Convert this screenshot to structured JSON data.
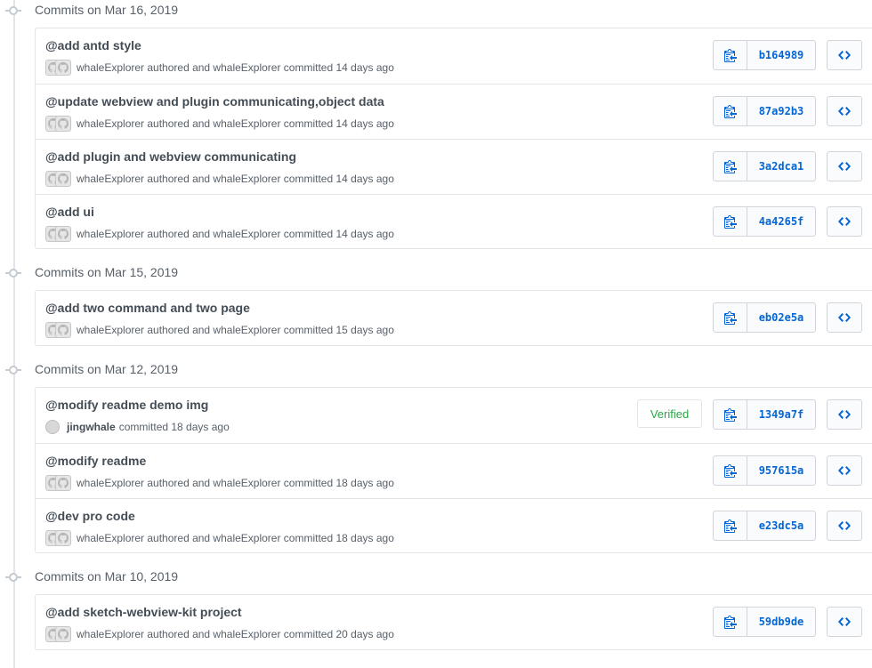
{
  "groups": [
    {
      "title": "Commits on Mar 16, 2019",
      "commits": [
        {
          "message": "@add antd style",
          "meta": "whaleExplorer authored and whaleExplorer committed 14 days ago",
          "sha": "b164989"
        },
        {
          "message": "@update webview and plugin communicating,object data",
          "meta": "whaleExplorer authored and whaleExplorer committed 14 days ago",
          "sha": "87a92b3"
        },
        {
          "message": "@add plugin and webview communicating",
          "meta": "whaleExplorer authored and whaleExplorer committed 14 days ago",
          "sha": "3a2dca1"
        },
        {
          "message": "@add ui",
          "meta": "whaleExplorer authored and whaleExplorer committed 14 days ago",
          "sha": "4a4265f"
        }
      ]
    },
    {
      "title": "Commits on Mar 15, 2019",
      "commits": [
        {
          "message": "@add two command and two page",
          "meta": "whaleExplorer authored and whaleExplorer committed 15 days ago",
          "sha": "eb02e5a"
        }
      ]
    },
    {
      "title": "Commits on Mar 12, 2019",
      "commits": [
        {
          "message": "@modify readme demo img",
          "author": "jingwhale",
          "meta": "committed 18 days ago",
          "sha": "1349a7f",
          "verified": "Verified"
        },
        {
          "message": "@modify readme",
          "meta": "whaleExplorer authored and whaleExplorer committed 18 days ago",
          "sha": "957615a"
        },
        {
          "message": "@dev pro code",
          "meta": "whaleExplorer authored and whaleExplorer committed 18 days ago",
          "sha": "e23dc5a"
        }
      ]
    },
    {
      "title": "Commits on Mar 10, 2019",
      "commits": [
        {
          "message": "@add sketch-webview-kit project",
          "meta": "whaleExplorer authored and whaleExplorer committed 20 days ago",
          "sha": "59db9de"
        }
      ]
    }
  ],
  "icons": {
    "copy": "clippy-icon",
    "browse": "code-icon",
    "avatar": "github-avatar-icon"
  },
  "colors": {
    "sha_link": "#0366d6",
    "verified": "#28a745",
    "border": "#e1e4e8"
  }
}
